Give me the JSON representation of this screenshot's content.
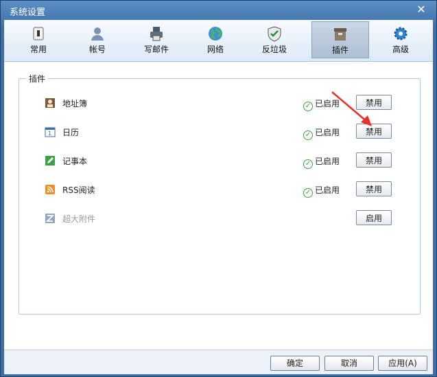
{
  "window": {
    "title": "系统设置",
    "close_glyph": "✕"
  },
  "toolbar": [
    {
      "label": "常用",
      "icon": "switch-icon",
      "active": false
    },
    {
      "label": "帐号",
      "icon": "user-icon",
      "active": false
    },
    {
      "label": "写邮件",
      "icon": "printer-icon",
      "active": false
    },
    {
      "label": "网络",
      "icon": "globe-icon",
      "active": false
    },
    {
      "label": "反垃圾",
      "icon": "shield-icon",
      "active": false
    },
    {
      "label": "插件",
      "icon": "box-icon",
      "active": true
    },
    {
      "label": "高级",
      "icon": "gear-icon",
      "active": false
    }
  ],
  "plugins_group": {
    "title": "插件",
    "items": [
      {
        "name": "地址簿",
        "icon": "address-book-icon",
        "status": "已启用",
        "button": "禁用"
      },
      {
        "name": "日历",
        "icon": "calendar-icon",
        "status": "已启用",
        "button": "禁用"
      },
      {
        "name": "记事本",
        "icon": "notepad-icon",
        "status": "已启用",
        "button": "禁用"
      },
      {
        "name": "RSS阅读",
        "icon": "rss-icon",
        "status": "已启用",
        "button": "禁用"
      },
      {
        "name": "超大附件",
        "icon": "attachment-icon",
        "status": "",
        "button": "启用"
      }
    ]
  },
  "footer": {
    "ok": "确定",
    "cancel": "取消",
    "apply": "应用(A)"
  },
  "colors": {
    "accent": "#3c6fa8",
    "enabled_check": "#3aa148",
    "annotation_arrow": "#e8302a"
  }
}
